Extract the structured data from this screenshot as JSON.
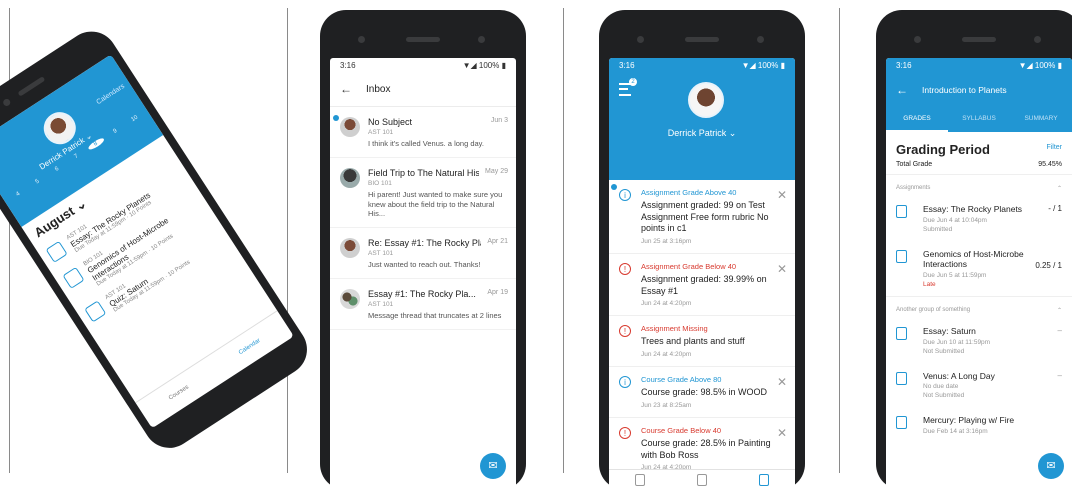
{
  "colors": {
    "brand": "#2196d3",
    "alert": "#d83a2f",
    "phone": "#1f2022"
  },
  "phone1": {
    "user_name": "Derrick Patrick ⌄",
    "calendars_link": "Calendars",
    "month": "August ⌄",
    "week": [
      "Sun",
      "Mon",
      "Tue",
      "Wed",
      "Thu",
      "Fri",
      "Sat"
    ],
    "days": [
      "4",
      "5",
      "6",
      "7",
      "8",
      "9",
      "10"
    ],
    "items": [
      {
        "course": "AST 101",
        "title": "Essay: The Rocky Planets",
        "sub": "Due Today at 11:59pm · 10 Points"
      },
      {
        "course": "BIO 101",
        "title": "Genomics of Host-Microbe Interactions",
        "sub": "Due Today at 11:59pm · 10 Points"
      },
      {
        "course": "AST 101",
        "title": "Quiz: Saturn",
        "sub": "Due Today at 11:59pm · 10 Points"
      }
    ],
    "nav": [
      "Courses",
      "Calendar"
    ]
  },
  "phone2": {
    "status_time": "3:16",
    "status_right": "▼◢ 100% ▮",
    "title": "Inbox",
    "items": [
      {
        "title": "No Subject",
        "date": "Jun 3",
        "course": "AST 101",
        "preview": "I think it's called Venus. a long day.",
        "unread": true
      },
      {
        "title": "Field Trip to The Natural His...",
        "date": "May 29",
        "course": "BIO 101",
        "preview": "Hi parent! Just wanted to make sure you knew about the field trip to the Natural His...",
        "unread": false
      },
      {
        "title": "Re: Essay #1: The Rocky Pla...",
        "date": "Apr 21",
        "course": "AST 101",
        "preview": "Just wanted to reach out. Thanks!",
        "unread": false
      },
      {
        "title": "Essay #1: The Rocky Pla...",
        "date": "Apr 19",
        "course": "AST 101",
        "preview": "Message thread that truncates at 2 lines",
        "unread": false
      }
    ]
  },
  "phone3": {
    "status_time": "3:16",
    "status_right": "▼◢ 100% ▮",
    "badge": "2",
    "user_name": "Derrick Patrick ⌄",
    "items": [
      {
        "kind": "info",
        "type": "Assignment Grade Above 40",
        "message": "Assignment graded: 99 on Test Assignment Free form rubric No points in c1",
        "date": "Jun 25 at 3:16pm",
        "unread": true
      },
      {
        "kind": "warn",
        "type": "Assignment Grade Below 40",
        "message": "Assignment graded: 39.99% on Essay #1",
        "date": "Jun 24 at 4:20pm",
        "unread": false
      },
      {
        "kind": "warn",
        "type": "Assignment Missing",
        "message": "Trees and plants and stuff",
        "date": "Jun 24 at 4:20pm",
        "unread": false
      },
      {
        "kind": "info",
        "type": "Course Grade Above 80",
        "message": "Course grade: 98.5% in WOOD",
        "date": "Jun 23 at 8:25am",
        "unread": false
      },
      {
        "kind": "warn",
        "type": "Course Grade Below 40",
        "message": "Course grade: 28.5% in Painting with Bob Ross",
        "date": "Jun 24 at 4:20pm",
        "unread": false
      }
    ]
  },
  "phone4": {
    "status_time": "3:16",
    "status_right": "▼◢ 100% ▮",
    "title": "Introduction to Planets",
    "tabs": [
      "GRADES",
      "SYLLABUS",
      "SUMMARY"
    ],
    "grading_period": "Grading Period",
    "filter": "Filter",
    "total_label": "Total Grade",
    "total_value": "95.45%",
    "sections": [
      {
        "label": "Assignments",
        "rows": [
          {
            "title": "Essay: The Rocky Planets",
            "sub1": "Due Jun 4 at 10:04pm",
            "sub2": "Submitted",
            "score": "- / 1",
            "late": ""
          },
          {
            "title": "Genomics of Host-Microbe Interactions",
            "sub1": "Due Jun 5 at 11:59pm",
            "sub2": "",
            "score": "0.25 / 1",
            "late": "Late"
          }
        ]
      },
      {
        "label": "Another group of something",
        "rows": [
          {
            "title": "Essay: Saturn",
            "sub1": "Due Jun 10 at 11:59pm",
            "sub2": "Not Submitted",
            "score": "–",
            "late": ""
          },
          {
            "title": "Venus: A Long Day",
            "sub1": "No due date",
            "sub2": "Not Submitted",
            "score": "–",
            "late": ""
          },
          {
            "title": "Mercury: Playing w/ Fire",
            "sub1": "Due Feb 14 at 3:16pm",
            "sub2": "",
            "score": "",
            "late": ""
          }
        ]
      }
    ]
  }
}
